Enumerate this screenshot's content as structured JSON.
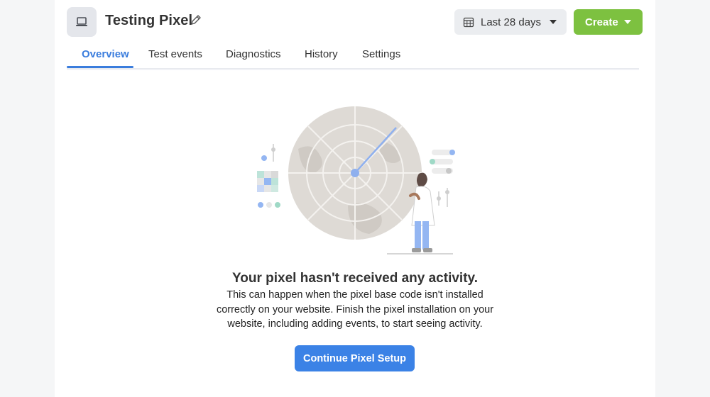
{
  "header": {
    "title": "Testing Pixel",
    "icon": "laptop-icon",
    "edit_icon": "pencil-icon"
  },
  "toolbar": {
    "date_range_label": "Last 28 days",
    "date_icon": "calendar-icon",
    "create_label": "Create"
  },
  "tabs": [
    {
      "label": "Overview",
      "active": true
    },
    {
      "label": "Test events",
      "active": false
    },
    {
      "label": "Diagnostics",
      "active": false
    },
    {
      "label": "History",
      "active": false
    },
    {
      "label": "Settings",
      "active": false
    }
  ],
  "empty_state": {
    "title": "Your pixel hasn't received any activity.",
    "body": "This can happen when the pixel base code isn't installed correctly on your website. Finish the pixel installation on your website, including adding events, to start seeing activity.",
    "button_label": "Continue Pixel Setup"
  },
  "colors": {
    "accent": "#3b7ddd",
    "create": "#7dc140",
    "primary_button": "#3b82e6"
  }
}
